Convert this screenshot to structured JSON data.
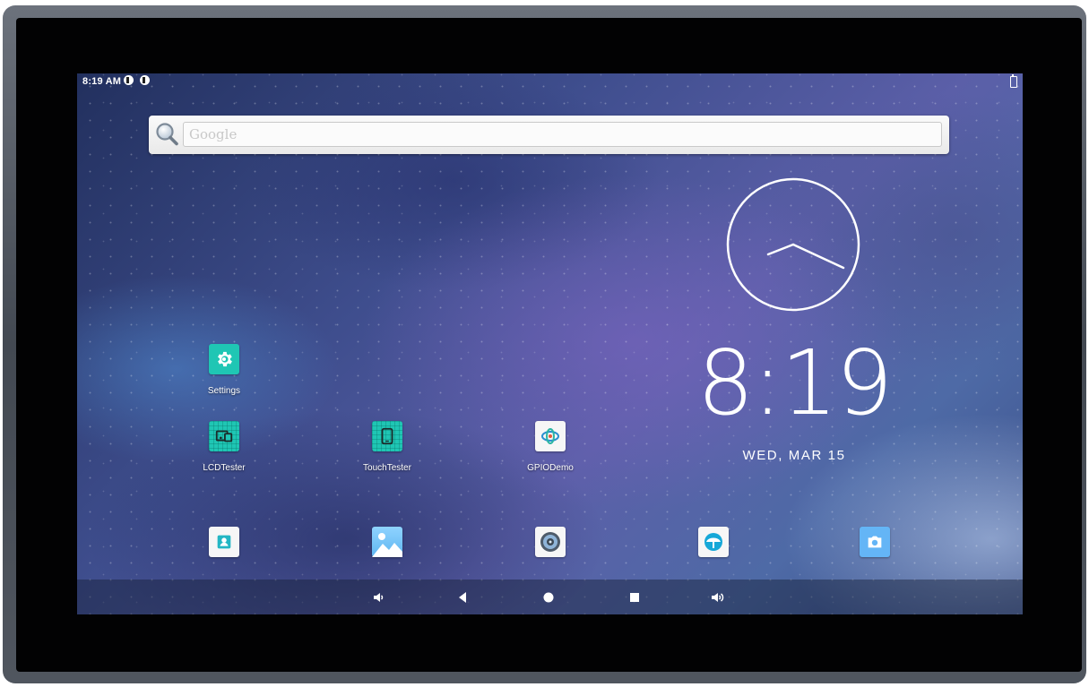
{
  "status_bar": {
    "time": "8:19 AM",
    "notification_icons": [
      "notification-icon",
      "notification-icon"
    ],
    "battery_icon": "battery-icon"
  },
  "search": {
    "placeholder": "Google",
    "icon": "search-icon"
  },
  "clock": {
    "time": "8:19",
    "date": "WED, MAR 15"
  },
  "apps": [
    {
      "label": "Settings",
      "icon": "settings-gear-icon"
    },
    {
      "label": "LCDTester",
      "icon": "lcd-tester-icon"
    },
    {
      "label": "TouchTester",
      "icon": "touch-tester-icon"
    },
    {
      "label": "GPIODemo",
      "icon": "gpio-demo-icon"
    }
  ],
  "dock": [
    {
      "icon": "contacts-icon"
    },
    {
      "icon": "gallery-icon"
    },
    {
      "icon": "music-icon"
    },
    {
      "icon": "browser-icon"
    },
    {
      "icon": "camera-icon"
    }
  ],
  "nav_bar": {
    "buttons": [
      "volume-down-icon",
      "back-icon",
      "home-icon",
      "recents-icon",
      "volume-up-icon"
    ]
  },
  "colors": {
    "app_tile_teal": "#1fc6b4",
    "text": "#ffffff"
  }
}
